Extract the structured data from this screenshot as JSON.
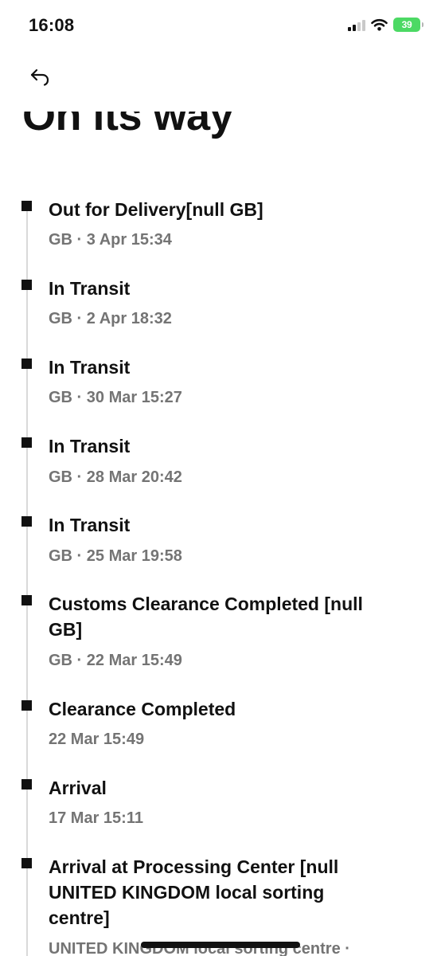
{
  "status_bar": {
    "time": "16:08",
    "battery": "39"
  },
  "header": {
    "back_icon": "back-arrow-icon",
    "title": "On its way"
  },
  "events": [
    {
      "title": "Out for Delivery[null GB]",
      "meta": "GB · 3 Apr 15:34"
    },
    {
      "title": "In Transit",
      "meta": "GB · 2 Apr 18:32"
    },
    {
      "title": "In Transit",
      "meta": "GB · 30 Mar 15:27"
    },
    {
      "title": "In Transit",
      "meta": "GB · 28 Mar 20:42"
    },
    {
      "title": "In Transit",
      "meta": "GB · 25 Mar 19:58"
    },
    {
      "title": "Customs Clearance Completed [null GB]",
      "meta": "GB · 22 Mar 15:49"
    },
    {
      "title": "Clearance Completed",
      "meta": "22 Mar 15:49"
    },
    {
      "title": "Arrival",
      "meta": "17 Mar 15:11"
    },
    {
      "title": "Arrival at Processing Center [null UNITED KINGDOM local sorting centre]",
      "meta": "UNITED KINGDOM local sorting centre ·"
    }
  ]
}
